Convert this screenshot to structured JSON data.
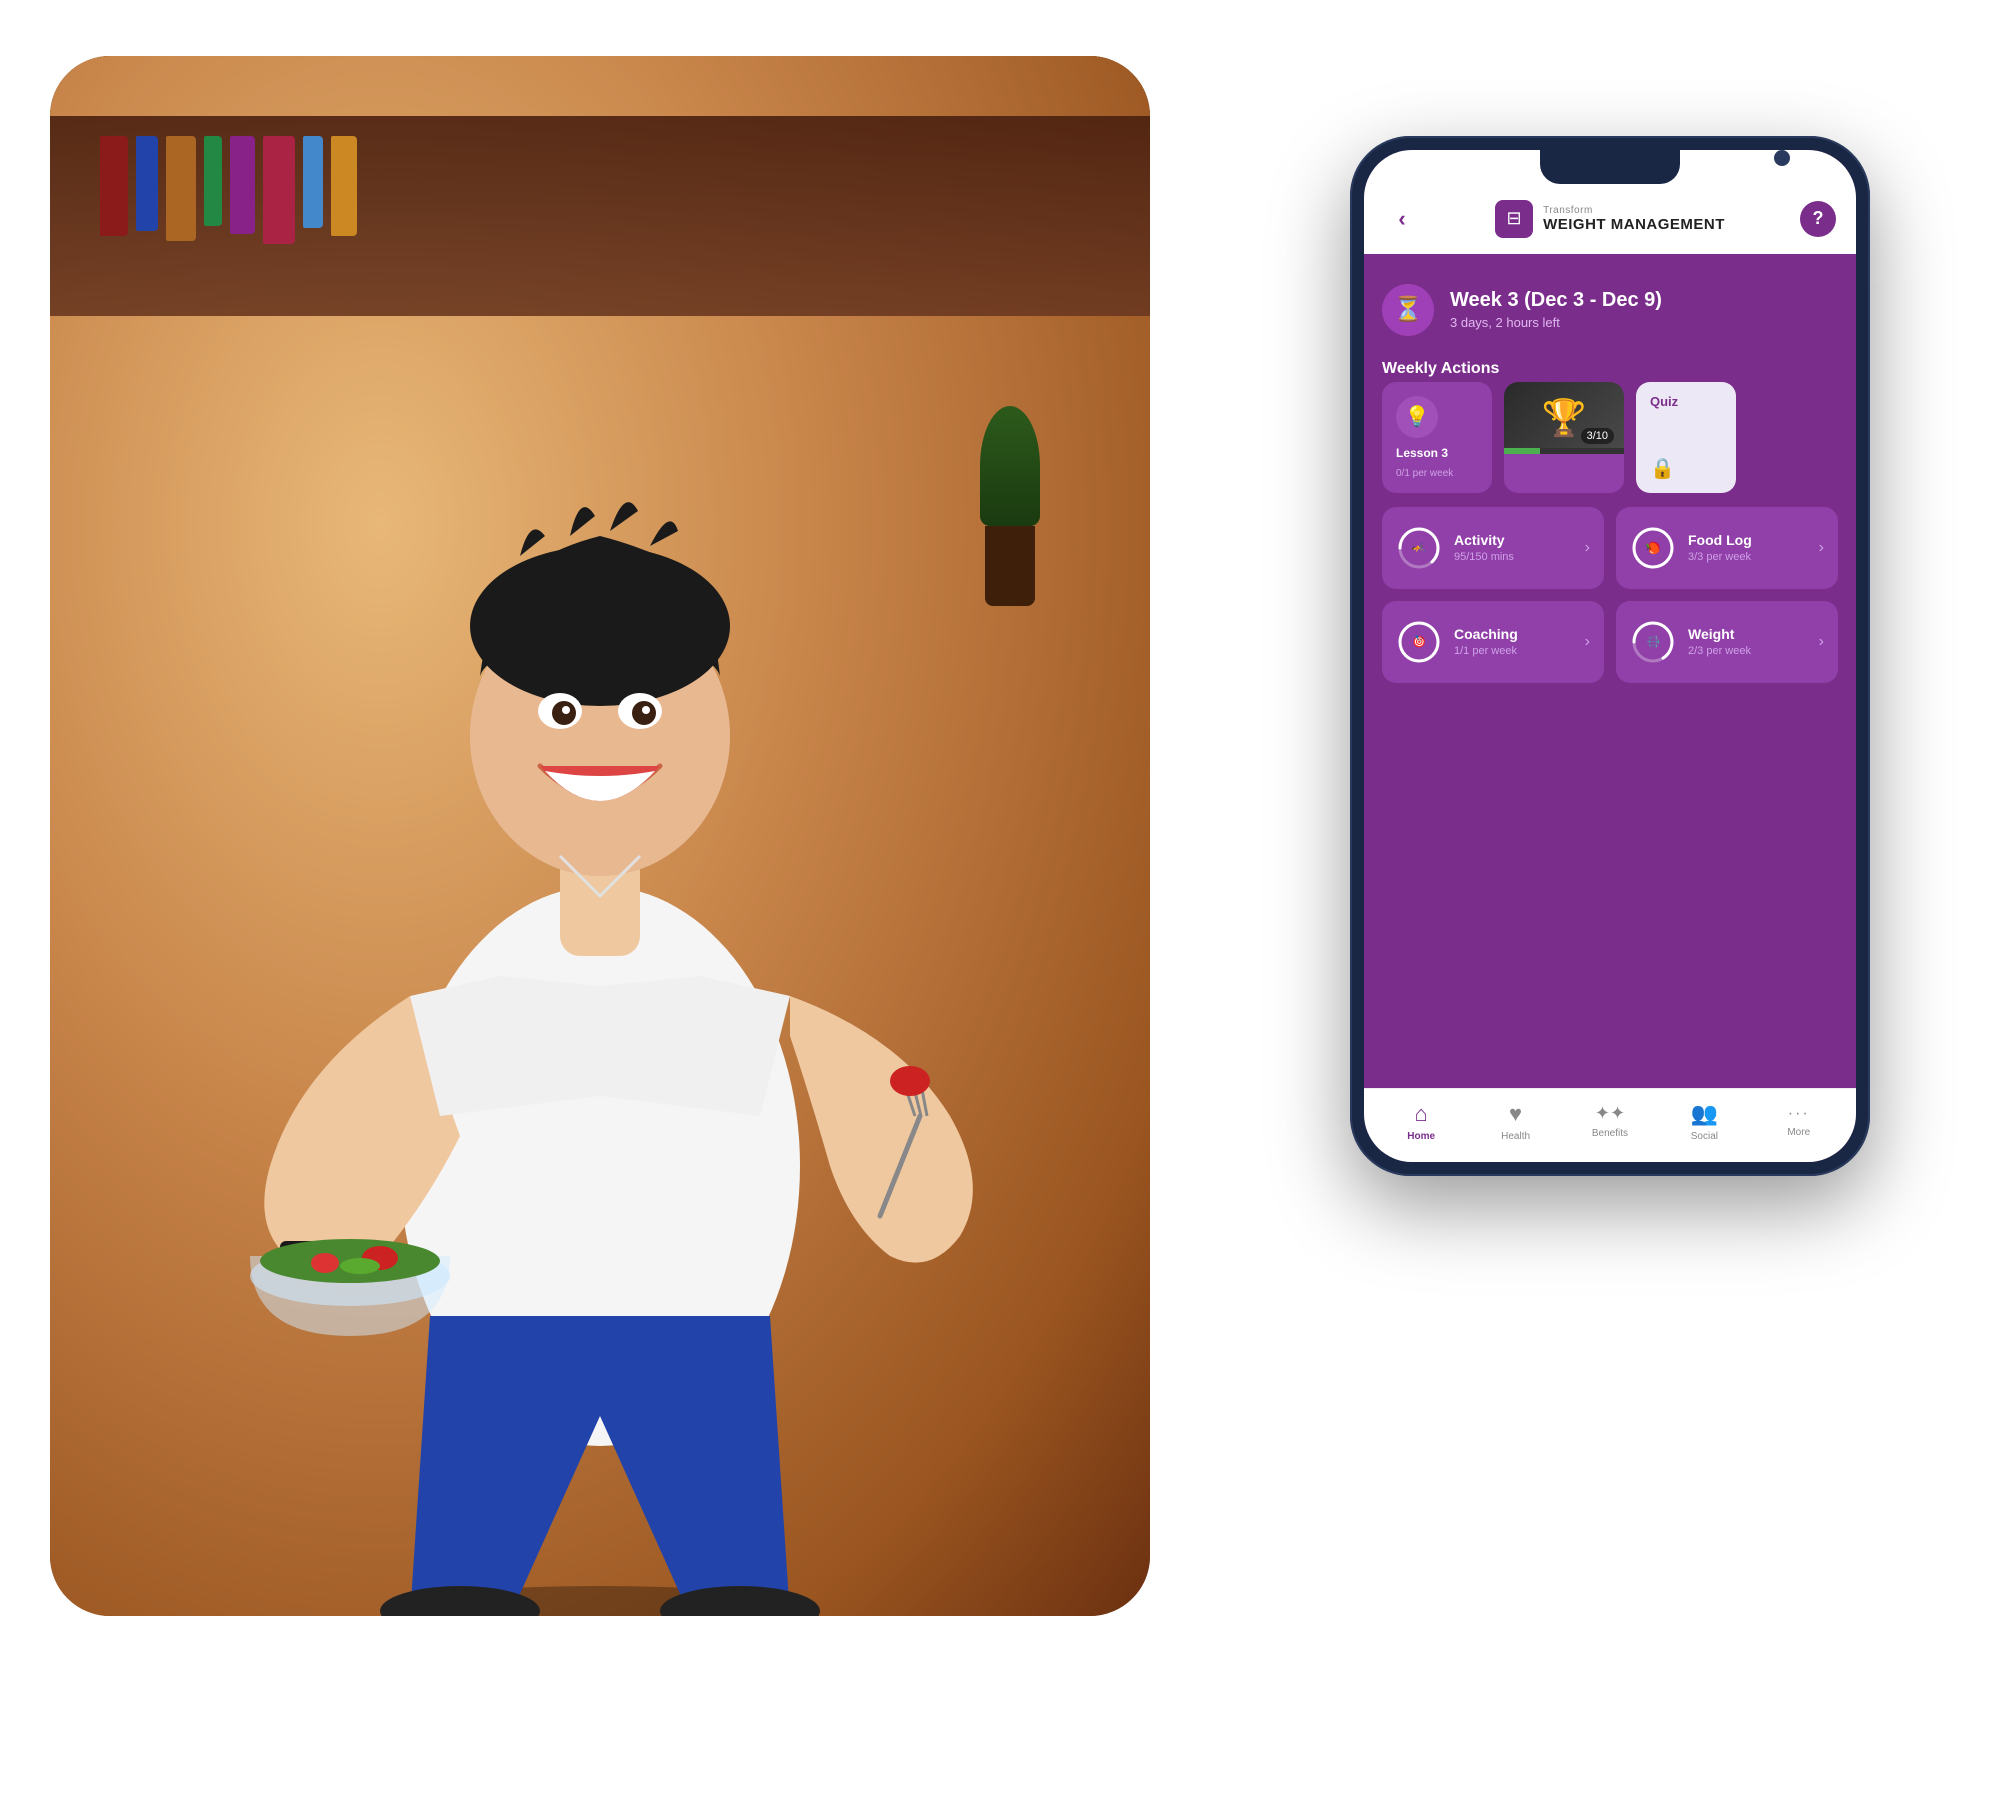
{
  "app": {
    "phone": {
      "topbar": {
        "back_label": "‹",
        "brand_subtitle": "Transform",
        "brand_title": "WEIGHT MANAGEMENT",
        "help_label": "?"
      },
      "week": {
        "title": "Week 3 (Dec 3 - Dec 9)",
        "subtitle": "3 days, 2 hours left",
        "icon": "⏳"
      },
      "weekly_actions_title": "Weekly Actions",
      "lesson": {
        "label": "Lesson 3",
        "sublabel": "0/1 per week"
      },
      "achievement": {
        "count": "3/10"
      },
      "quiz": {
        "title": "Quiz",
        "lock": "🔒"
      },
      "grid_items": [
        {
          "title": "Activity",
          "subtitle": "95/150 mins",
          "progress": 63,
          "icon": "🏃"
        },
        {
          "title": "Food Log",
          "subtitle": "3/3 per week",
          "progress": 100,
          "icon": "🍎"
        },
        {
          "title": "Coaching",
          "subtitle": "1/1 per week",
          "progress": 100,
          "icon": "🎯"
        },
        {
          "title": "Weight",
          "subtitle": "2/3 per week",
          "progress": 66,
          "icon": "⚖️"
        }
      ],
      "bottom_nav": [
        {
          "icon": "🏠",
          "label": "Home",
          "active": true
        },
        {
          "icon": "♥",
          "label": "Health",
          "active": false
        },
        {
          "icon": "✨",
          "label": "Benefits",
          "active": false
        },
        {
          "icon": "👥",
          "label": "Social",
          "active": false
        },
        {
          "icon": "···",
          "label": "More",
          "active": false
        }
      ]
    }
  },
  "colors": {
    "brand_purple": "#7b2d8b",
    "card_purple": "#9040a8",
    "light_purple": "#a050b8",
    "text_dim": "#d0a0e8",
    "white": "#ffffff",
    "phone_body": "#1a2744"
  }
}
